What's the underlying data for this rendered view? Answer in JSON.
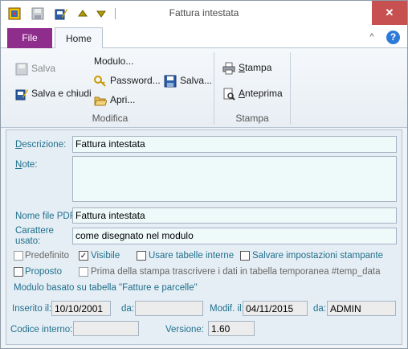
{
  "window": {
    "title": "Fattura intestata",
    "close_glyph": "✕"
  },
  "quick_access": [
    {
      "name": "app-icon"
    },
    {
      "name": "save-icon"
    },
    {
      "name": "edit-icon"
    },
    {
      "name": "arrow-up-icon"
    },
    {
      "name": "arrow-down-icon"
    }
  ],
  "ribbon": {
    "tabs": {
      "file": "File",
      "home": "Home"
    },
    "modifica": {
      "salva": "Salva",
      "salva_e_chiudi": "Salva e chiudi",
      "modulo": "Modulo...",
      "password": "Password...",
      "salva_menu": "Salva...",
      "apri": "Apri...",
      "group_label": "Modifica"
    },
    "stampa": {
      "stampa": "Stampa",
      "anteprima": "Anteprima",
      "group_label": "Stampa"
    },
    "help_glyph": "?",
    "collapse_glyph": "^"
  },
  "form": {
    "descrizione_label": "Descrizione:",
    "descrizione_value": "Fattura intestata",
    "note_label": "Note:",
    "note_value": "",
    "nome_file_pdf_label": "Nome file PDF:",
    "nome_file_pdf_value": "Fattura intestata",
    "carattere_label_1": "Carattere",
    "carattere_label_2": "usato:",
    "carattere_value": "come disegnato nel modulo",
    "checkbox_predefinito": "Predefinito",
    "checkbox_visibile": "Visibile",
    "checkbox_usare_tabelle": "Usare tabelle interne",
    "checkbox_salvare_impostazioni": "Salvare impostazioni stampante",
    "checkbox_proposto": "Proposto",
    "checkbox_prima_stampa": "Prima della stampa trascrivere i dati in tabella temporanea #temp_data",
    "modulo_basato": "Modulo basato su tabella \"Fatture e parcelle\"",
    "inserito_il_label": "Inserito il:",
    "inserito_il_value": "10/10/2001",
    "da_label_1": "da:",
    "da_value_1": "",
    "modif_il_label": "Modif. il:",
    "modif_il_value": "04/11/2015",
    "da_label_2": "da:",
    "da_value_2": "ADMIN",
    "codice_interno_label": "Codice interno:",
    "codice_interno_value": "",
    "versione_label": "Versione:",
    "versione_value": "1.60",
    "visibile_checked": true,
    "predefinito_checked": false
  }
}
